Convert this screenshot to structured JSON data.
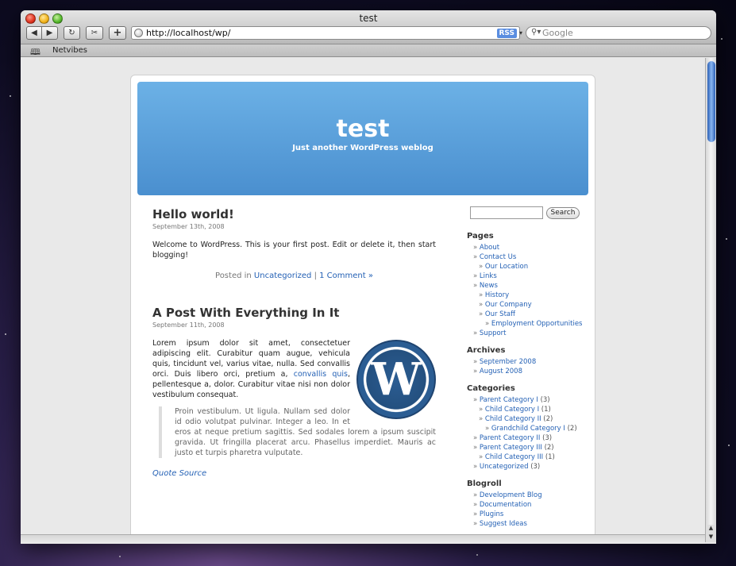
{
  "window": {
    "title": "test"
  },
  "toolbar": {
    "url": "http://localhost/wp/",
    "rss_label": "RSS",
    "search_placeholder": "Google",
    "add_label": "+"
  },
  "bookmarks": {
    "items": [
      "Netvibes"
    ]
  },
  "site": {
    "title": "test",
    "description": "Just another WordPress weblog"
  },
  "posts": [
    {
      "title": "Hello world!",
      "date": "September 13th, 2008",
      "body": "Welcome to WordPress. This is your first post. Edit or delete it, then start blogging!",
      "meta_prefix": "Posted in",
      "category": "Uncategorized",
      "separator": "|",
      "comments": "1 Comment »"
    },
    {
      "title": "A Post With Everything In It",
      "date": "September 11th, 2008",
      "body_before": "Lorem ipsum dolor sit amet, consectetuer adipiscing elit. Curabitur quam augue, vehicula quis, tincidunt vel, varius vitae, nulla. Sed convallis orci. Duis libero orci, pretium a,",
      "body_link": "convallis quis",
      "body_after": ", pellentesque a, dolor. Curabitur vitae nisi non dolor vestibulum consequat.",
      "quote": "Proin vestibulum. Ut ligula. Nullam sed dolor id odio volutpat pulvinar. Integer a leo. In et eros at neque pretium sagittis. Sed sodales lorem a ipsum suscipit gravida. Ut fringilla placerat arcu. Phasellus imperdiet. Mauris ac justo et turpis pharetra vulputate.",
      "quote_source": "Quote Source"
    }
  ],
  "sidebar": {
    "search_button": "Search",
    "pages_heading": "Pages",
    "pages": [
      {
        "label": "About",
        "level": 1
      },
      {
        "label": "Contact Us",
        "level": 1
      },
      {
        "label": "Our Location",
        "level": 2
      },
      {
        "label": "Links",
        "level": 1
      },
      {
        "label": "News",
        "level": 1
      },
      {
        "label": "History",
        "level": 2
      },
      {
        "label": "Our Company",
        "level": 2
      },
      {
        "label": "Our Staff",
        "level": 2
      },
      {
        "label": "Employment Opportunities",
        "level": 3
      },
      {
        "label": "Support",
        "level": 1
      }
    ],
    "archives_heading": "Archives",
    "archives": [
      "September 2008",
      "August 2008"
    ],
    "categories_heading": "Categories",
    "categories": [
      {
        "label": "Parent Category I",
        "count": "(3)",
        "level": 1
      },
      {
        "label": "Child Category I",
        "count": "(1)",
        "level": 2
      },
      {
        "label": "Child Category II",
        "count": "(2)",
        "level": 2
      },
      {
        "label": "Grandchild Category I",
        "count": "(2)",
        "level": 3
      },
      {
        "label": "Parent Category II",
        "count": "(3)",
        "level": 1
      },
      {
        "label": "Parent Category III",
        "count": "(2)",
        "level": 1
      },
      {
        "label": "Child Category III",
        "count": "(1)",
        "level": 2
      },
      {
        "label": "Uncategorized",
        "count": "(3)",
        "level": 1
      }
    ],
    "blogroll_heading": "Blogroll",
    "blogroll": [
      "Development Blog",
      "Documentation",
      "Plugins",
      "Suggest Ideas"
    ]
  }
}
